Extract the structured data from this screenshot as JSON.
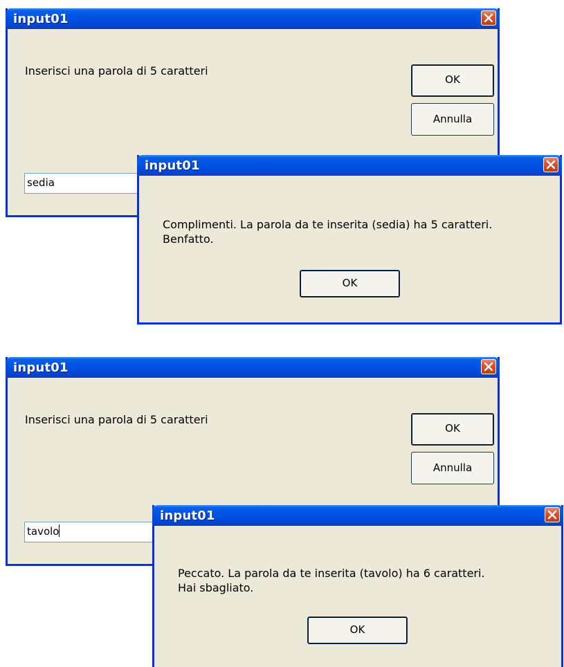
{
  "top_example": {
    "input_dialog": {
      "title": "input01",
      "prompt": "Inserisci una parola di 5 caratteri",
      "ok_label": "OK",
      "cancel_label": "Annulla",
      "input_value": "sedia"
    },
    "message_dialog": {
      "title": "input01",
      "message_line1": "Complimenti. La parola da te inserita (sedia) ha 5 caratteri.",
      "message_line2": "Benfatto.",
      "ok_label": "OK"
    }
  },
  "bottom_example": {
    "input_dialog": {
      "title": "input01",
      "prompt": "Inserisci una parola di 5 caratteri",
      "ok_label": "OK",
      "cancel_label": "Annulla",
      "input_value": "tavolo"
    },
    "message_dialog": {
      "title": "input01",
      "message_line1": "Peccato. La parola da te inserita (tavolo) ha 6 caratteri.",
      "message_line2": "Hai sbagliato.",
      "ok_label": "OK"
    }
  },
  "icons": {
    "close": "close-x-icon"
  },
  "colors": {
    "titlebar": "#0055e5",
    "window_bg": "#ece9d8",
    "close_button": "#d9542e"
  }
}
